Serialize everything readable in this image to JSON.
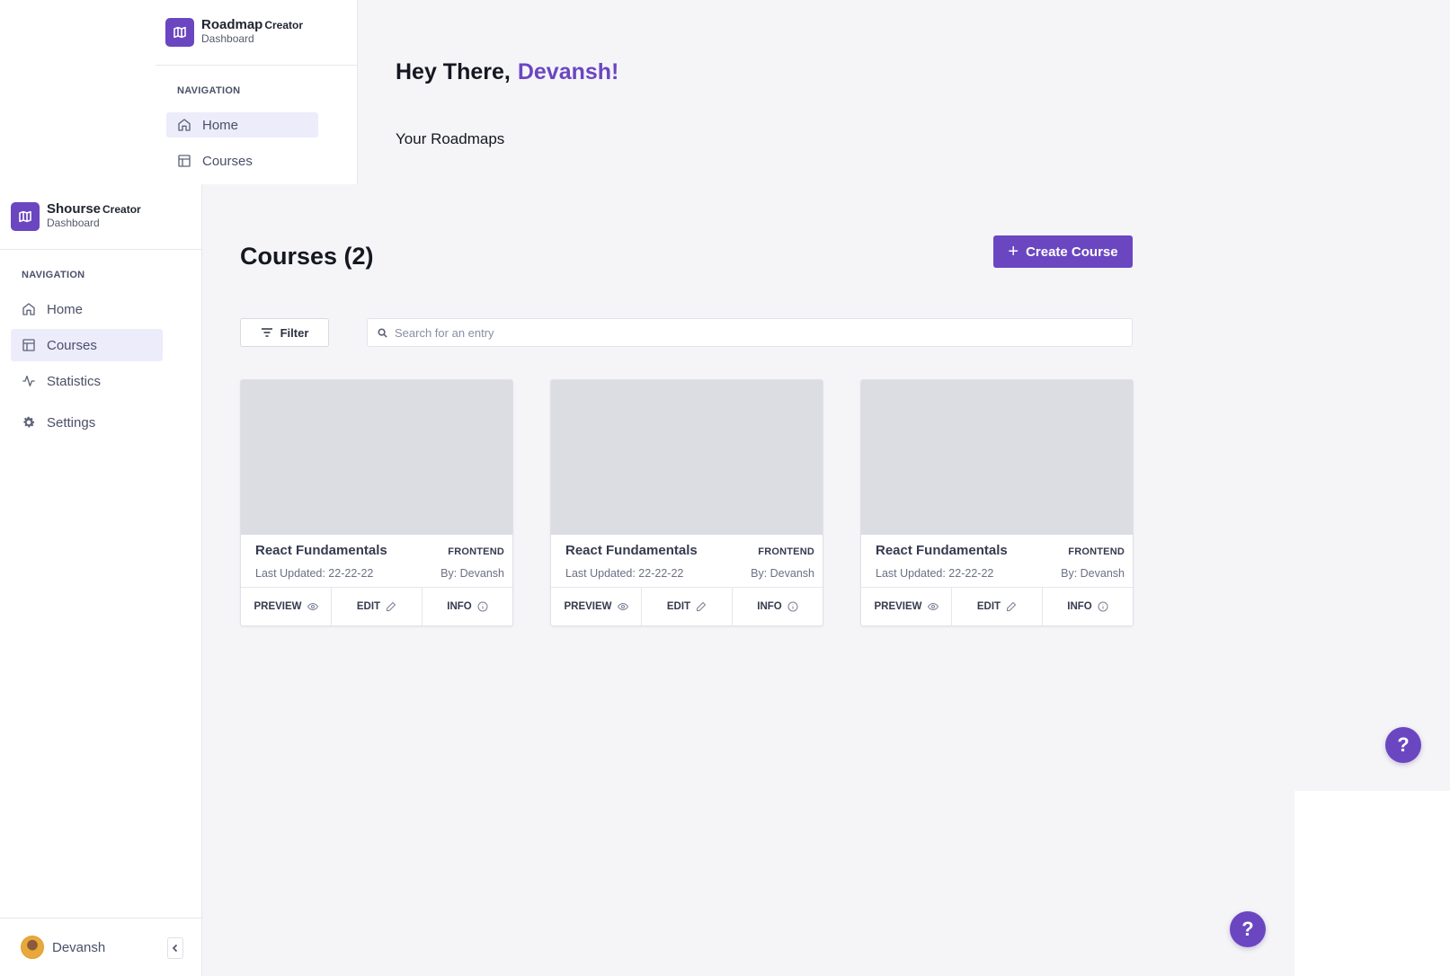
{
  "back_window": {
    "brand": {
      "name": "Roadmap",
      "creator": "Creator",
      "sub": "Dashboard"
    },
    "nav_heading": "NAVIGATION",
    "nav": [
      {
        "label": "Home",
        "icon": "home-icon",
        "active": true
      },
      {
        "label": "Courses",
        "icon": "table-icon",
        "active": false
      }
    ],
    "greeting": {
      "prefix": "Hey There,",
      "name": "Devansh!"
    },
    "section_title": "Your Roadmaps",
    "help_label": "?"
  },
  "front_window": {
    "brand": {
      "name": "Shourse",
      "creator": "Creator",
      "sub": "Dashboard"
    },
    "nav_heading": "NAVIGATION",
    "nav": [
      {
        "label": "Home",
        "icon": "home-icon",
        "active": false
      },
      {
        "label": "Courses",
        "icon": "table-icon",
        "active": true
      },
      {
        "label": "Statistics",
        "icon": "activity-icon",
        "active": false
      },
      {
        "label": "Settings",
        "icon": "gear-icon",
        "active": false
      }
    ],
    "page_title": "Courses (2)",
    "create_button": "Create Course",
    "filter_button": "Filter",
    "search": {
      "placeholder": "Search for an entry",
      "value": ""
    },
    "cards": [
      {
        "title": "React Fundamentals",
        "tag": "FRONTEND",
        "updated": "Last Updated: 22-22-22",
        "author": "By: Devansh",
        "actions": [
          "PREVIEW",
          "EDIT",
          "INFO"
        ]
      },
      {
        "title": "React Fundamentals",
        "tag": "FRONTEND",
        "updated": "Last Updated: 22-22-22",
        "author": "By: Devansh",
        "actions": [
          "PREVIEW",
          "EDIT",
          "INFO"
        ]
      },
      {
        "title": "React Fundamentals",
        "tag": "FRONTEND",
        "updated": "Last Updated: 22-22-22",
        "author": "By: Devansh",
        "actions": [
          "PREVIEW",
          "EDIT",
          "INFO"
        ]
      }
    ],
    "user": {
      "name": "Devansh"
    },
    "help_label": "?"
  },
  "colors": {
    "accent": "#6b46c1",
    "active_nav_bg": "#ececfb",
    "main_bg": "#f5f5f8",
    "thumb": "#dcdce3"
  }
}
